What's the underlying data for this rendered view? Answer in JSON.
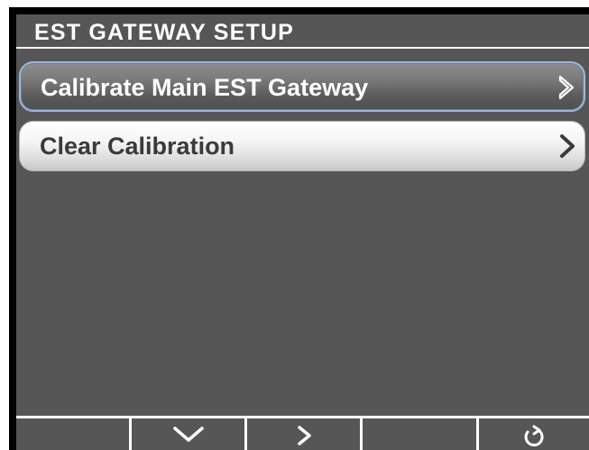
{
  "title": "EST GATEWAY SETUP",
  "menu": {
    "items": [
      {
        "label": "Calibrate Main EST Gateway",
        "selected": true,
        "icon": "chevron-right-outline-icon"
      },
      {
        "label": "Clear Calibration",
        "selected": false,
        "icon": "chevron-right-icon"
      }
    ]
  },
  "softkeys": [
    {
      "name": "softkey-1",
      "icon": ""
    },
    {
      "name": "softkey-2",
      "icon": "chevron-down-icon"
    },
    {
      "name": "softkey-3",
      "icon": "chevron-right-icon"
    },
    {
      "name": "softkey-4",
      "icon": ""
    },
    {
      "name": "softkey-5",
      "icon": "back-arrow-icon"
    }
  ],
  "colors": {
    "background": "#565656",
    "frame": "#000000",
    "text": "#ffffff",
    "selected_border": "#9fb6d6"
  }
}
